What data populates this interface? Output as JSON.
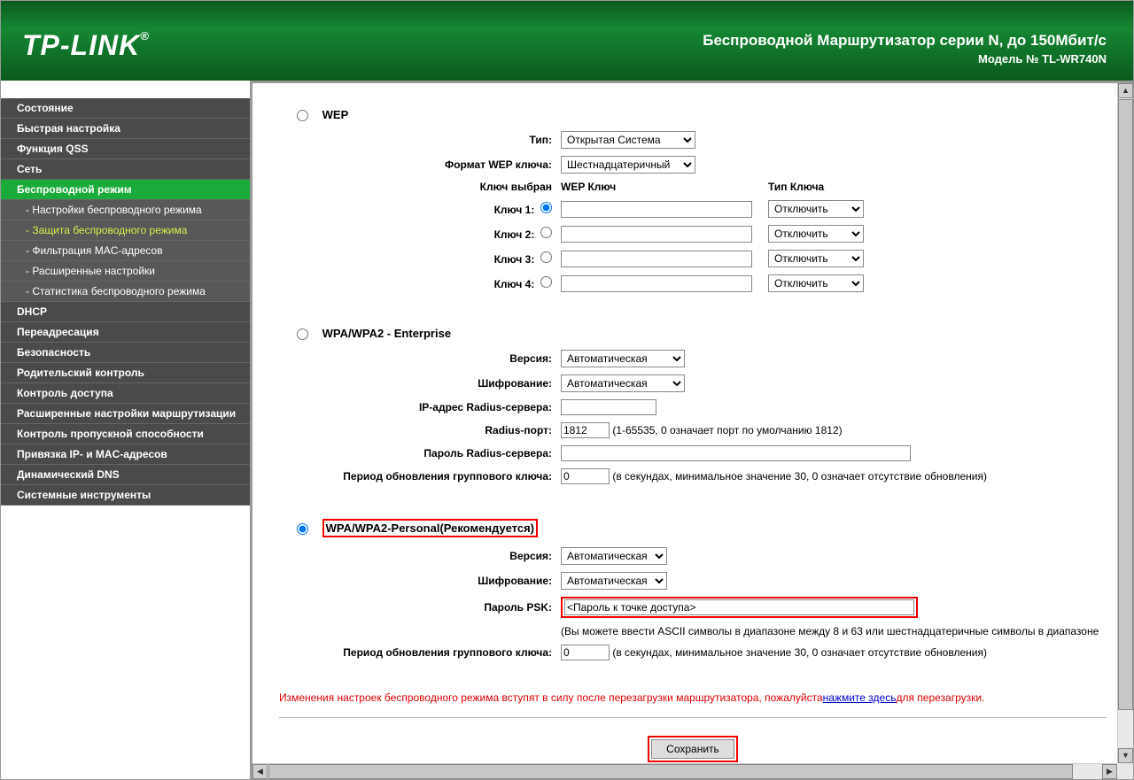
{
  "header": {
    "logo": "TP-LINK",
    "title": "Беспроводной Маршрутизатор серии N, до 150Мбит/с",
    "model": "Модель № TL-WR740N"
  },
  "sidebar": {
    "items": [
      {
        "label": "Состояние",
        "type": "main"
      },
      {
        "label": "Быстрая настройка",
        "type": "main"
      },
      {
        "label": "Функция QSS",
        "type": "main"
      },
      {
        "label": "Сеть",
        "type": "main"
      },
      {
        "label": "Беспроводной режим",
        "type": "main",
        "active": true
      },
      {
        "label": "- Настройки беспроводного режима",
        "type": "sub"
      },
      {
        "label": "- Защита беспроводного режима",
        "type": "sub",
        "activeSub": true
      },
      {
        "label": "- Фильтрация MAC-адресов",
        "type": "sub"
      },
      {
        "label": "- Расширенные настройки",
        "type": "sub"
      },
      {
        "label": "- Статистика беспроводного режима",
        "type": "sub"
      },
      {
        "label": "DHCP",
        "type": "main"
      },
      {
        "label": "Переадресация",
        "type": "main"
      },
      {
        "label": "Безопасность",
        "type": "main"
      },
      {
        "label": "Родительский контроль",
        "type": "main"
      },
      {
        "label": "Контроль доступа",
        "type": "main"
      },
      {
        "label": "Расширенные настройки маршрутизации",
        "type": "main"
      },
      {
        "label": "Контроль пропускной способности",
        "type": "main"
      },
      {
        "label": "Привязка IP- и MAC-адресов",
        "type": "main"
      },
      {
        "label": "Динамический DNS",
        "type": "main"
      },
      {
        "label": "Системные инструменты",
        "type": "main"
      }
    ]
  },
  "wep": {
    "title": "WEP",
    "type_label": "Тип:",
    "type_value": "Открытая Система",
    "format_label": "Формат WEP ключа:",
    "format_value": "Шестнадцатеричный",
    "selected_label": "Ключ выбран",
    "key_header": "WEP Ключ",
    "type_header": "Тип Ключа",
    "keys": [
      {
        "label": "Ключ 1:",
        "type": "Отключить"
      },
      {
        "label": "Ключ 2:",
        "type": "Отключить"
      },
      {
        "label": "Ключ 3:",
        "type": "Отключить"
      },
      {
        "label": "Ключ 4:",
        "type": "Отключить"
      }
    ]
  },
  "enterprise": {
    "title": "WPA/WPA2 - Enterprise",
    "version_label": "Версия:",
    "version_value": "Автоматическая",
    "encryption_label": "Шифрование:",
    "encryption_value": "Автоматическая",
    "radius_ip_label": "IP-адрес Radius-сервера:",
    "radius_ip_value": "",
    "radius_port_label": "Radius-порт:",
    "radius_port_value": "1812",
    "radius_port_hint": "(1-65535, 0 означает порт по умолчанию 1812)",
    "radius_pass_label": "Пароль Radius-сервера:",
    "radius_pass_value": "",
    "group_key_label": "Период обновления группового ключа:",
    "group_key_value": "0",
    "group_key_hint": "(в секундах, минимальное значение 30, 0 означает отсутствие обновления)"
  },
  "personal": {
    "title": "WPA/WPA2-Personal(Рекомендуется)",
    "version_label": "Версия:",
    "version_value": "Автоматическая",
    "encryption_label": "Шифрование:",
    "encryption_value": "Автоматическая",
    "psk_label": "Пароль PSK:",
    "psk_value": "<Пароль к точке доступа>",
    "psk_hint": "(Вы можете ввести ASCII символы в диапазоне между 8 и 63 или шестнадцатеричные символы в диапазоне",
    "group_key_label": "Период обновления группового ключа:",
    "group_key_value": "0",
    "group_key_hint": "(в секундах, минимальное значение 30, 0 означает отсутствие обновления)"
  },
  "notice": {
    "text1": "Изменения настроек беспроводного режима вступят в силу после перезагрузки маршрутизатора, пожалуйста",
    "link": "нажмите здесь",
    "text2": "для перезагрузки."
  },
  "save_label": "Сохранить"
}
